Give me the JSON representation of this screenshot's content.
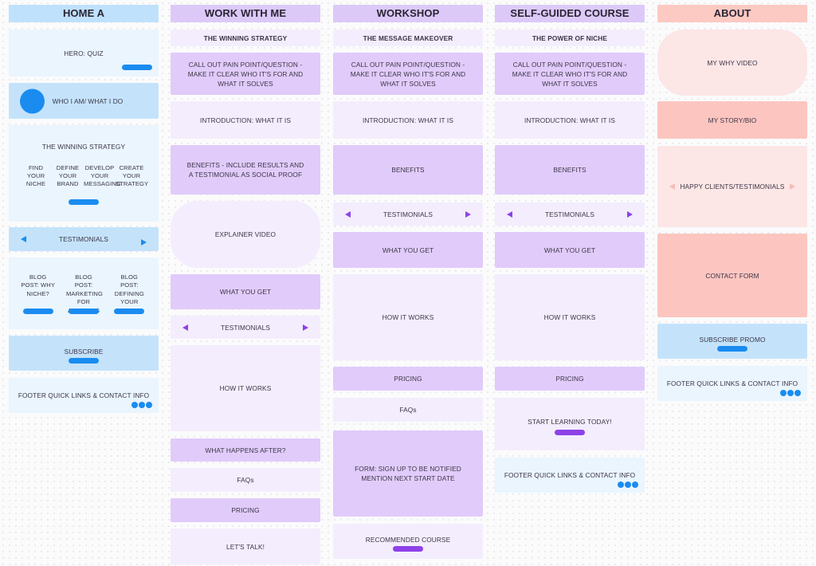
{
  "columns": [
    {
      "title": "HOME A",
      "blocks": {
        "hero": "HERO: QUIZ",
        "who": "WHO I AM/ WHAT I DO",
        "strategy": {
          "title": "THE WINNING STRATEGY",
          "steps": [
            "FIND YOUR NICHE",
            "DEFINE YOUR BRAND",
            "DEVELOP YOUR MESSAGING",
            "CREATE YOUR STRATEGY"
          ]
        },
        "testimonials": "TESTIMONIALS",
        "blog_posts": [
          "BLOG POST: WHY NICHE?",
          "BLOG POST: MARKETING FOR ADVISORS",
          "BLOG POST: DEFINING YOUR BRAND"
        ],
        "subscribe": "SUBSCRIBE",
        "footer": "FOOTER QUICK LINKS & CONTACT INFO"
      }
    },
    {
      "title": "WORK WITH ME",
      "blocks": {
        "subtitle": "THE WINNING STRATEGY",
        "callout": "CALL OUT PAIN POINT/QUESTION - MAKE IT CLEAR WHO IT'S FOR AND WHAT IT SOLVES",
        "intro": "INTRODUCTION: WHAT IT IS",
        "benefits": "BENEFITS - INCLUDE RESULTS AND A TESTIMONIAL AS SOCIAL PROOF",
        "video": "EXPLAINER VIDEO",
        "what_you_get": "WHAT YOU GET",
        "testimonials": "TESTIMONIALS",
        "how_it_works": "HOW IT WORKS",
        "what_after": "WHAT HAPPENS AFTER?",
        "faqs": "FAQs",
        "pricing": "PRICING",
        "lets_talk": "LET'S TALK!"
      }
    },
    {
      "title": "WORKSHOP",
      "blocks": {
        "subtitle": "THE MESSAGE MAKEOVER",
        "callout": "CALL OUT PAIN POINT/QUESTION - MAKE IT CLEAR WHO IT'S FOR AND WHAT IT SOLVES",
        "intro": "INTRODUCTION: WHAT IT IS",
        "benefits": "BENEFITS",
        "testimonials": "TESTIMONIALS",
        "what_you_get": "WHAT YOU GET",
        "how_it_works": "HOW IT WORKS",
        "pricing": "PRICING",
        "faqs": "FAQs",
        "form_line1": "FORM: SIGN UP TO BE NOTIFIED",
        "form_line2": "MENTION NEXT START DATE",
        "recommended": "RECOMMENDED COURSE"
      }
    },
    {
      "title": "SELF-GUIDED COURSE",
      "blocks": {
        "subtitle": "THE POWER OF NICHE",
        "callout": "CALL OUT PAIN POINT/QUESTION - MAKE IT CLEAR WHO IT'S FOR AND WHAT IT SOLVES",
        "intro": "INTRODUCTION: WHAT IT IS",
        "benefits": "BENEFITS",
        "testimonials": "TESTIMONIALS",
        "what_you_get": "WHAT YOU GET",
        "how_it_works": "HOW IT WORKS",
        "pricing": "PRICING",
        "start": "START LEARNING TODAY!",
        "footer": "FOOTER QUICK LINKS & CONTACT INFO"
      }
    },
    {
      "title": "ABOUT",
      "blocks": {
        "why_video": "MY WHY VIDEO",
        "story": "MY STORY/BIO",
        "happy_clients": "HAPPY CLIENTS/TESTIMONIALS",
        "contact": "CONTACT FORM",
        "subscribe": "SUBSCRIBE PROMO",
        "footer": "FOOTER QUICK LINKS & CONTACT INFO"
      }
    }
  ],
  "colors": {
    "blue_accent": "#1a8cf0",
    "purple_accent": "#8e41e8",
    "blue_header": "#bfe1fb",
    "purple_header": "#dcc9f8",
    "red_header": "#fdc9c3"
  }
}
